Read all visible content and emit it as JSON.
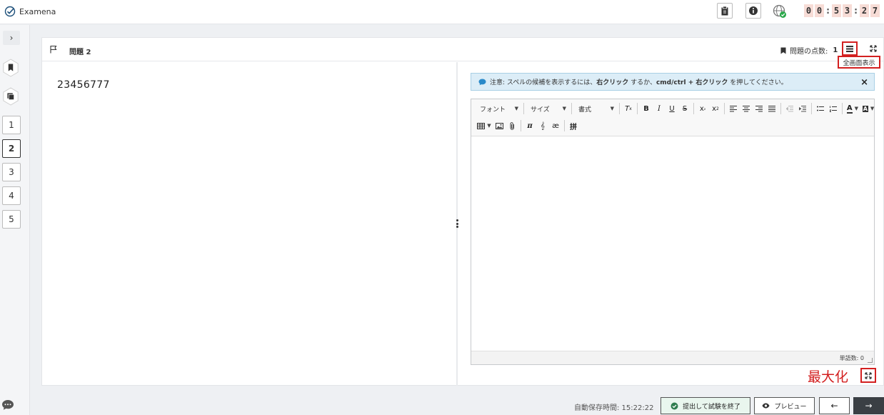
{
  "app": {
    "name": "Examena"
  },
  "timer": {
    "digits": [
      "0",
      "0",
      "5",
      "3",
      "2",
      "7"
    ]
  },
  "sidebar": {
    "toggle_label": "›",
    "questions": [
      "1",
      "2",
      "3",
      "4",
      "5"
    ],
    "active_question": "2"
  },
  "question": {
    "title": "問題 2",
    "points_label": "問題の点数:",
    "points_value": "1",
    "answer_text": "23456777",
    "fullscreen_tooltip": "全画面表示"
  },
  "notice": {
    "prefix": "注意: スペルの候補を表示するには、",
    "bold1": "右クリック",
    "mid": " するか、",
    "bold2": "cmd/ctrl + 右クリック",
    "suffix": " を押してください。",
    "close": "×"
  },
  "editor": {
    "font_label": "フォント",
    "size_label": "サイズ",
    "format_label": "書式",
    "word_count": "単語数: 0"
  },
  "annotation": {
    "maximize_label": "最大化"
  },
  "footer": {
    "autosave": "自動保存時間: 15:22:22",
    "submit_label": "提出して試験を終了",
    "preview_label": "プレビュー",
    "prev_label": "←",
    "next_label": "→"
  }
}
